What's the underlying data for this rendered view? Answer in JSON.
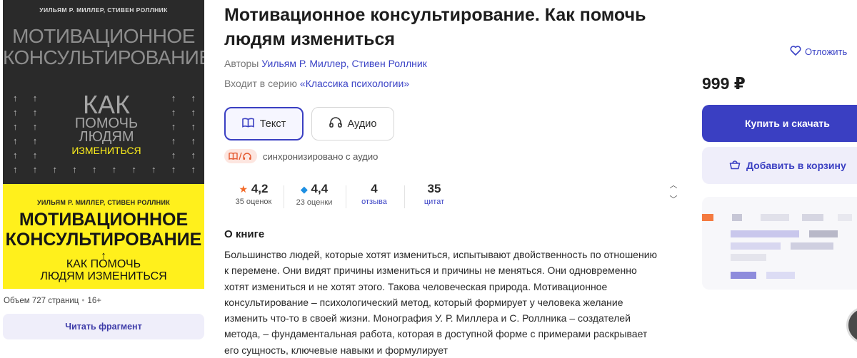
{
  "cover": {
    "authors_top": "УИЛЬЯМ Р. МИЛЛЕР, СТИВЕН РОЛЛНИК",
    "title_line1": "МОТИВАЦИОННОЕ",
    "title_line2": "КОНСУЛЬТИРОВАНИЕ",
    "kak_line1": "КАК",
    "kak_line2": "ПОМОЧЬ",
    "kak_line3": "ЛЮДЯМ",
    "kak_line4": "ИЗМЕНИТЬСЯ",
    "authors_bottom": "УИЛЬЯМ Р. МИЛЛЕР, СТИВЕН РОЛЛНИК",
    "title_y_line1": "МОТИВАЦИОННОЕ",
    "title_y_line2": "КОНСУЛЬТИРОВАНИЕ",
    "arrow": "↑",
    "sub_y_line1": "КАК ПОМОЧЬ",
    "sub_y_line2": "ЛЮДЯМ ИЗМЕНИТЬСЯ",
    "colors": {
      "dark": "#2a2a2a",
      "yellow": "#fff01c"
    }
  },
  "meta": {
    "pages": "Объем 727 страниц",
    "age": "16+"
  },
  "read_fragment_label": "Читать фрагмент",
  "book": {
    "title": "Мотивационное консультирование. Как помочь людям измениться",
    "authors_label": "Авторы",
    "authors": "Уильям Р. Миллер, Стивен Роллник",
    "series_label": "Входит в серию",
    "series": "«Классика психологии»"
  },
  "formats": {
    "text_label": "Текст",
    "audio_label": "Аудио"
  },
  "sync": {
    "badge": "📖/🎧",
    "text": "синхронизировано с аудио"
  },
  "stats": {
    "rating1": {
      "value": "4,2",
      "label": "35 оценок"
    },
    "rating2": {
      "value": "4,4",
      "label": "23 оценки"
    },
    "reviews": {
      "value": "4",
      "label": "отзыва"
    },
    "quotes": {
      "value": "35",
      "label": "цитат"
    }
  },
  "about": {
    "heading": "О книге",
    "text": "Большинство людей, которые хотят измениться, испытывают двойственность по отношению к перемене. Они видят причины измениться и причины не меняться. Они одновременно хотят измениться и не хотят этого. Такова человеческая природа. Мотивационное консультирование – психологический метод, который формирует у человека желание изменить что-то в своей жизни. Монография У. Р. Миллера и С. Роллника – создателей метода, – фундаментальная работа, которая в доступной форме с примерами раскрывает его сущность, ключевые навыки и формулирует"
  },
  "purchase": {
    "defer_label": "Отложить",
    "price": "999 ₽",
    "buy_label": "Купить и скачать",
    "cart_label": "Добавить в корзину"
  },
  "colors": {
    "accent": "#3a3fc2",
    "link": "#3b43c6",
    "star": "#f36b2a"
  }
}
